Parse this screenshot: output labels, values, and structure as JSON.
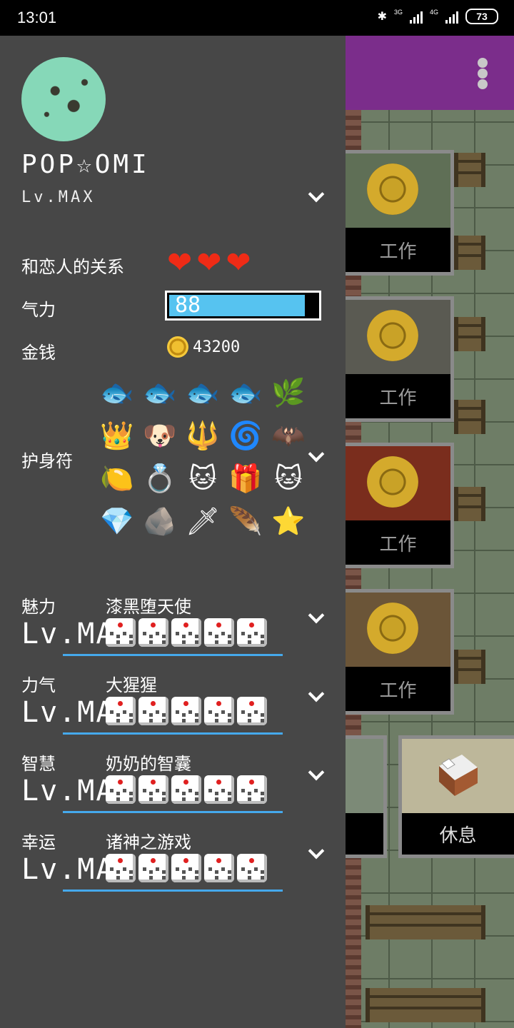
{
  "status_bar": {
    "time": "13:01",
    "network_1": "3G",
    "network_2": "4G",
    "battery": "73",
    "icons": [
      "bluetooth-icon",
      "signal-icon",
      "battery-icon"
    ]
  },
  "game": {
    "menu_icon": "more-vertical-icon",
    "jobs": [
      "工作",
      "工作",
      "工作",
      "工作"
    ],
    "rest_label": "休息"
  },
  "drawer": {
    "player_name": "POP☆OMI",
    "player_level": "Lv.MAX",
    "relationship_label": "和恋人的关系",
    "hearts": [
      "❤",
      "❤",
      "❤"
    ],
    "energy_label": "气力",
    "energy_value": "88",
    "energy_fraction": 0.92,
    "money_label": "金钱",
    "money_value": "43200",
    "amulet_label": "护身符",
    "amulets": [
      "🐟",
      "🐟",
      "🐟",
      "🐟",
      "🌿",
      "👑",
      "🐶",
      "🔱",
      "🌀",
      "🦇",
      "🍋",
      "💍",
      "🐱",
      "🎁",
      "🐱",
      "💎",
      "🪨",
      "🗡",
      "🪶",
      "⭐"
    ],
    "stats": [
      {
        "name": "魅力",
        "title": "漆黑堕天使",
        "level": "Lv.MAX"
      },
      {
        "name": "力气",
        "title": "大猩猩",
        "level": "Lv.MAX"
      },
      {
        "name": "智慧",
        "title": "奶奶的智囊",
        "level": "Lv.MAX"
      },
      {
        "name": "幸运",
        "title": "诸神之游戏",
        "level": "Lv.MAX"
      }
    ]
  }
}
